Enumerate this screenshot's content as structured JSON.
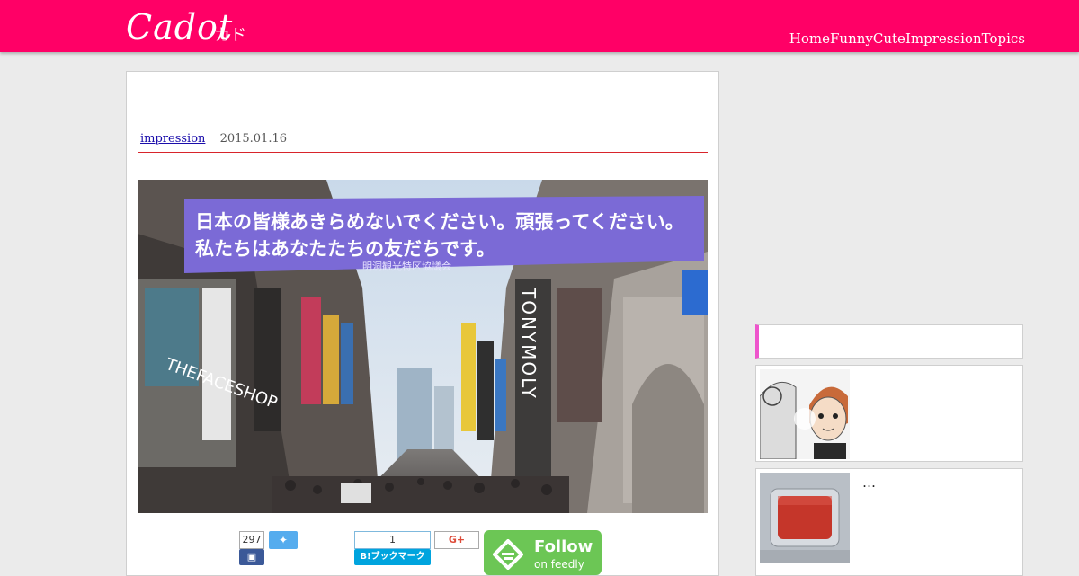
{
  "header": {
    "logo": "Cadot",
    "logo_kana": "カド",
    "nav": [
      "Home",
      "Funny",
      "Cute",
      "Impression",
      "Topics"
    ]
  },
  "article": {
    "category": "impression",
    "date": "2015.01.16",
    "photo": {
      "banner_line1": "日本の皆様あきらめないでください。頑張ってください。",
      "banner_line2": "私たちはあなたたちの友だちです。",
      "banner_small": "明洞観光特区協議会",
      "sign_faceshop": "THEFACESHOP",
      "sign_tonymoly": "TONYMOLY"
    }
  },
  "share": {
    "facebook_count": "297",
    "hatena_count": "1",
    "hatena_label": "B!ブックマーク",
    "gplus_label": "G+",
    "feedly_follow": "Follow",
    "feedly_sub": "on feedly"
  },
  "sidebar": {
    "cards": [
      {
        "title": ""
      },
      {
        "title": "…"
      }
    ]
  },
  "colors": {
    "brand": "#ff0066",
    "rule": "#d8242b",
    "accent_bar": "#ee55cc",
    "feedly_green": "#6cc655",
    "twitter": "#55acee",
    "hatena": "#00a4de",
    "facebook": "#3b5998"
  }
}
